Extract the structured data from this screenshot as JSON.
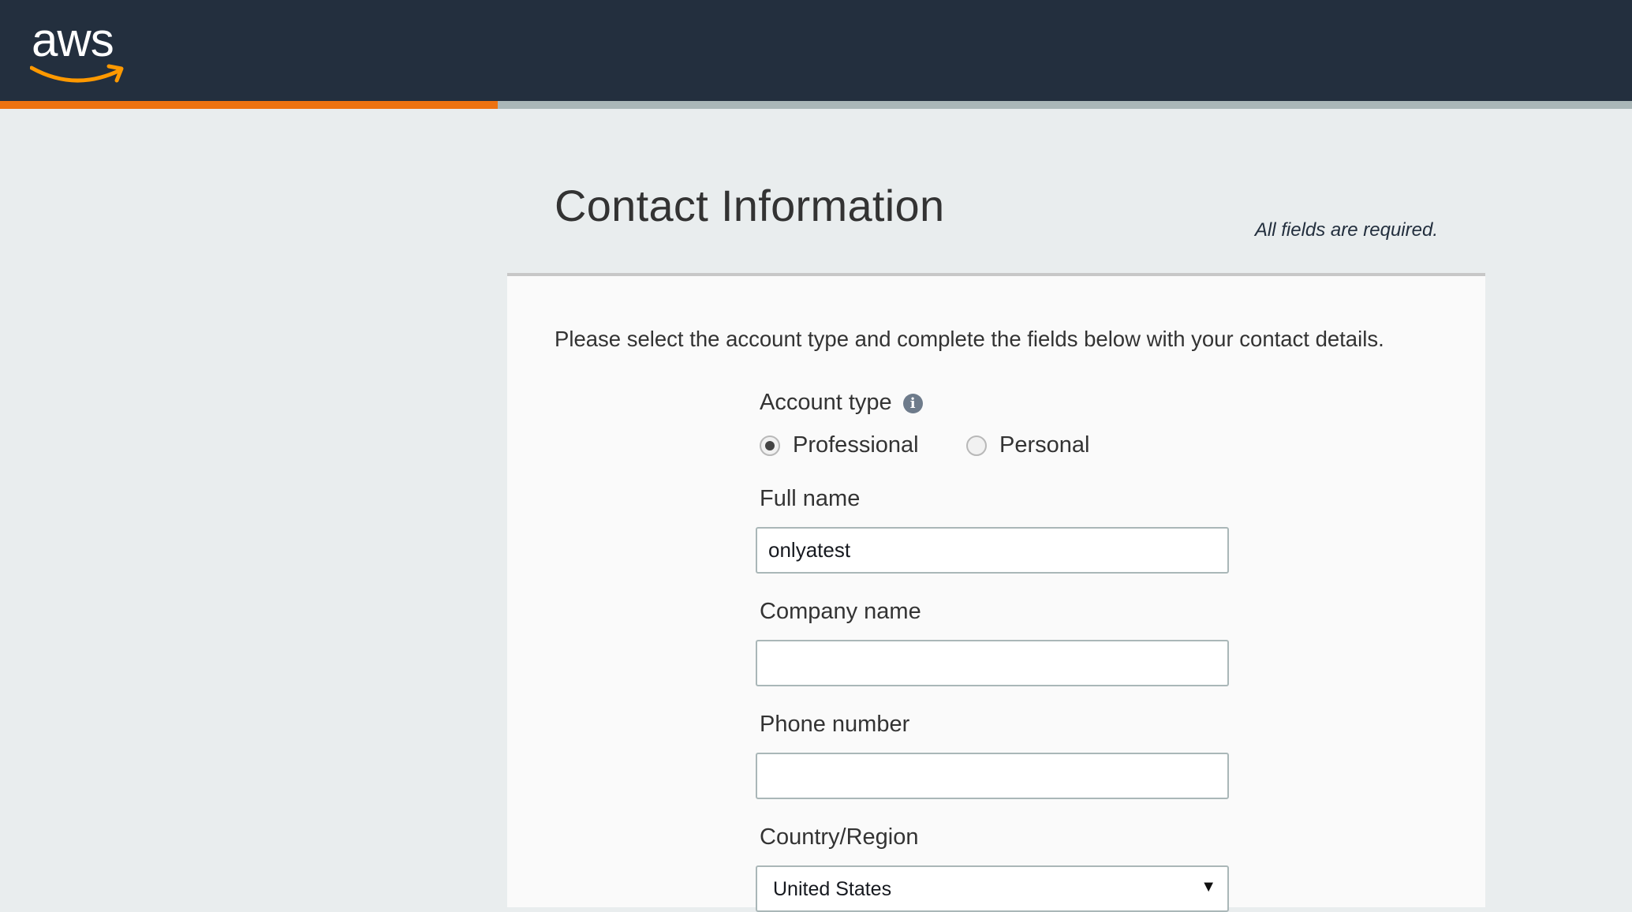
{
  "header": {
    "logo_text": "aws",
    "progress": 0.305,
    "progress_color": "#ec7211"
  },
  "page": {
    "title": "Contact Information",
    "required_note": "All fields are required.",
    "intro": "Please select the account type and complete the fields below with your contact details."
  },
  "form": {
    "account_type": {
      "label": "Account type",
      "info_icon": "i",
      "options": [
        {
          "label": "Professional",
          "selected": true
        },
        {
          "label": "Personal",
          "selected": false
        }
      ]
    },
    "full_name": {
      "label": "Full name",
      "value": "onlyatest"
    },
    "company_name": {
      "label": "Company name",
      "value": ""
    },
    "phone_number": {
      "label": "Phone number",
      "value": ""
    },
    "country_region": {
      "label": "Country/Region",
      "value": "United States",
      "arrow": "▼"
    }
  },
  "colors": {
    "header_bg": "#232f3e",
    "page_bg": "#e9edee",
    "card_bg": "#fafafa",
    "accent": "#ec7211"
  }
}
